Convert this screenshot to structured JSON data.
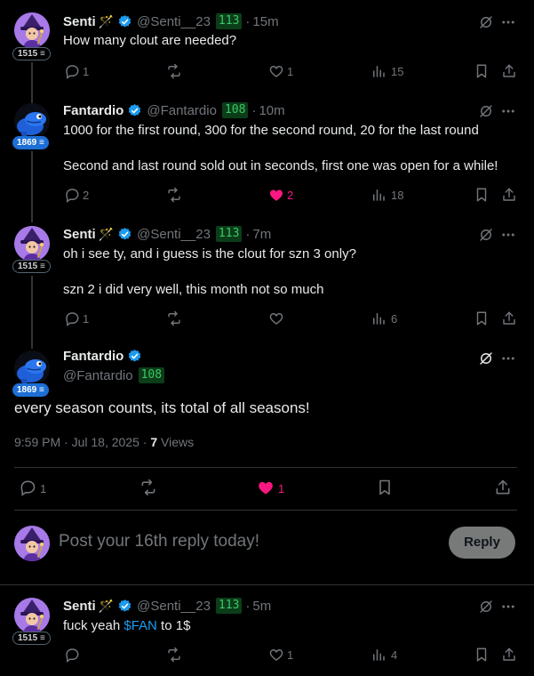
{
  "colors": {
    "accent": "#1d9bf0",
    "like": "#f91880",
    "clout_bg": "#0b3d19",
    "clout_fg": "#3cc864"
  },
  "posts": [
    {
      "name": "Senti",
      "emoji": "🪄",
      "handle": "@Senti__23",
      "clout": "113",
      "time": "15m",
      "avatar_badge": "1515 ≡",
      "lines": [
        "How many clout are needed?"
      ],
      "replies": "1",
      "reposts": "",
      "likes": "1",
      "views": "15",
      "liked": false
    },
    {
      "name": "Fantardio",
      "handle": "@Fantardio",
      "clout": "108",
      "time": "10m",
      "avatar_badge": "1869 ≡",
      "lines": [
        "1000 for the first round, 300 for the second round, 20 for the last round",
        "Second and last round sold out in seconds, first one was open for a while!"
      ],
      "replies": "2",
      "reposts": "",
      "likes": "2",
      "views": "18",
      "liked": true
    },
    {
      "name": "Senti",
      "emoji": "🪄",
      "handle": "@Senti__23",
      "clout": "113",
      "time": "7m",
      "avatar_badge": "1515 ≡",
      "lines": [
        "oh i see ty, and i guess is the clout for szn 3 only?",
        "szn 2 i did very well, this month not so much"
      ],
      "replies": "1",
      "reposts": "",
      "likes": "",
      "views": "6",
      "liked": false
    }
  ],
  "main_post": {
    "name": "Fantardio",
    "handle": "@Fantardio",
    "clout": "108",
    "avatar_badge": "1869 ≡",
    "text": "every season counts, its total of all seasons!",
    "timestamp": "9:59 PM · Jul 18, 2025 · ",
    "views_count": "7",
    "views_label": " Views",
    "replies": "1",
    "likes": "1"
  },
  "composer": {
    "placeholder": "Post your 16th reply today!",
    "button": "Reply"
  },
  "last_reply": {
    "name": "Senti",
    "emoji": "🪄",
    "handle": "@Senti__23",
    "clout": "113",
    "time": "5m",
    "avatar_badge": "1515 ≡",
    "text_before": "fuck yeah ",
    "cashtag": "$FAN",
    "text_after": " to 1$",
    "replies": "",
    "likes": "1",
    "views": "4"
  }
}
